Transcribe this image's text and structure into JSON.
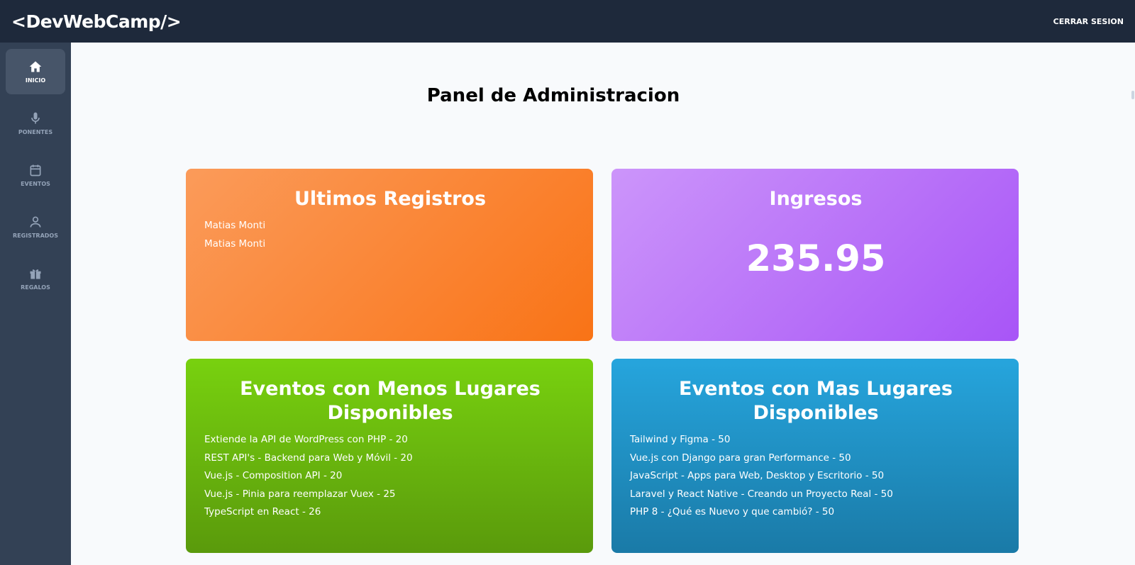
{
  "header": {
    "logo": "<DevWebCamp/>",
    "logout_label": "CERRAR SESION"
  },
  "sidebar": {
    "items": [
      {
        "label": "INICIO",
        "icon": "home-icon"
      },
      {
        "label": "PONENTES",
        "icon": "microphone-icon"
      },
      {
        "label": "EVENTOS",
        "icon": "calendar-icon"
      },
      {
        "label": "REGISTRADOS",
        "icon": "user-icon"
      },
      {
        "label": "REGALOS",
        "icon": "gift-icon"
      }
    ]
  },
  "main": {
    "title": "Panel de Administracion",
    "cards": {
      "registros": {
        "title": "Ultimos Registros",
        "items": [
          "Matias Monti",
          "Matias Monti"
        ]
      },
      "ingresos": {
        "title": "Ingresos",
        "value": "235.95"
      },
      "menos": {
        "title": "Eventos con Menos Lugares Disponibles",
        "items": [
          "Extiende la API de WordPress con PHP - 20",
          "REST API's - Backend para Web y Móvil - 20",
          "Vue.js - Composition API - 20",
          "Vue.js - Pinia para reemplazar Vuex - 25",
          "TypeScript en React - 26"
        ]
      },
      "mas": {
        "title": "Eventos con Mas Lugares Disponibles",
        "items": [
          "Tailwind y Figma - 50",
          "Vue.js con Django para gran Performance - 50",
          "JavaScript - Apps para Web, Desktop y Escritorio - 50",
          "Laravel y React Native - Creando un Proyecto Real - 50",
          "PHP 8 - ¿Qué es Nuevo y que cambió? - 50"
        ]
      }
    }
  },
  "colors": {
    "topbar": "#1e293b",
    "sidebar": "#334155",
    "orange": "#f97316",
    "purple": "#a855f7",
    "green": "#65a30d",
    "blue": "#1e90c8"
  }
}
